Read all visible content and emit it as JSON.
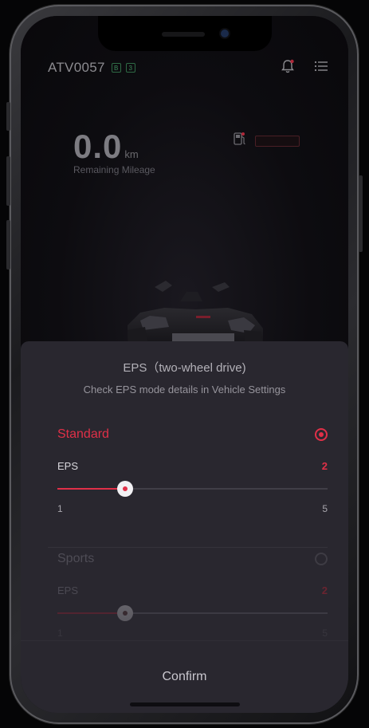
{
  "header": {
    "device_name": "ATV0057",
    "badges": [
      "B",
      "3"
    ],
    "icons": [
      "bell-icon",
      "menu-icon"
    ]
  },
  "dashboard": {
    "mileage_value": "0.0",
    "mileage_unit": "km",
    "mileage_label": "Remaining Mileage",
    "icons": [
      "fuel-icon"
    ]
  },
  "sheet": {
    "title": "EPS（two-wheel drive)",
    "subtitle": "Check EPS mode details in Vehicle Settings",
    "modes": [
      {
        "name": "Standard",
        "selected": true,
        "eps_label": "EPS",
        "eps_value": "2",
        "level": 2,
        "scale_min": "1",
        "scale_max": "5"
      },
      {
        "name": "Sports",
        "selected": false,
        "eps_label": "EPS",
        "eps_value": "2",
        "level": 2,
        "scale_min": "1",
        "scale_max": "5"
      }
    ],
    "confirm_label": "Confirm"
  },
  "colors": {
    "accent": "#e03048",
    "sheet_bg": "#29272f"
  }
}
